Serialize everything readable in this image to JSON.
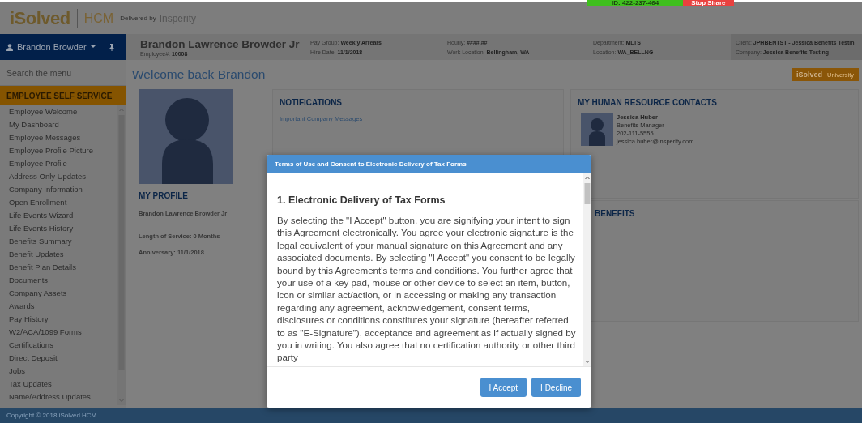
{
  "screen_share": {
    "id": "ID: 422-237-464",
    "stop": "Stop Share"
  },
  "header": {
    "logo": "iSolved",
    "product": "HCM",
    "delivered_by": "Delivered by",
    "partner": "Insperity"
  },
  "user_menu": {
    "name": "Brandon Browder"
  },
  "employee": {
    "name": "Brandon Lawrence Browder Jr",
    "number_label": "Employee#:",
    "number": "10008",
    "columns": [
      [
        {
          "label": "Pay Group:",
          "value": "Weekly Arrears"
        },
        {
          "label": "Hire Date:",
          "value": "11/1/2018"
        }
      ],
      [
        {
          "label": "Hourly:",
          "value": "####.##"
        },
        {
          "label": "Work Location:",
          "value": "Bellingham, WA"
        }
      ],
      [
        {
          "label": "Department:",
          "value": "MLTS"
        },
        {
          "label": "Location:",
          "value": "WA_BELLNG"
        }
      ],
      [
        {
          "label": "Client:",
          "value": "JPHBENTST - Jessica Benefits Testin"
        },
        {
          "label": "Company:",
          "value": "Jessica Benefits Testing"
        }
      ]
    ]
  },
  "search": {
    "placeholder": "Search the menu"
  },
  "menu": {
    "title": "EMPLOYEE SELF SERVICE",
    "items": [
      "Employee Welcome",
      "My Dashboard",
      "Employee Messages",
      "Employee Profile Picture",
      "Employee Profile",
      "Address Only Updates",
      "Company Information",
      "Open Enrollment",
      "Life Events Wizard",
      "Life Events History",
      "Benefits Summary",
      "Benefit Updates",
      "Benefit Plan Details",
      "Documents",
      "Company Assets",
      "Awards",
      "Pay History",
      "W2/ACA/1099 Forms",
      "Certifications",
      "Direct Deposit",
      "Jobs",
      "Tax Updates",
      "Name/Address Updates"
    ]
  },
  "welcome": "Welcome back Brandon",
  "university_badge": {
    "brand": "iSolved",
    "label": "University"
  },
  "profile": {
    "title": "MY PROFILE",
    "name": "Brandon Lawrence Browder Jr",
    "service": "Length of Service: 0 Months",
    "anniversary": "Anniversary: 11/1/2018"
  },
  "notifications": {
    "title": "NOTIFICATIONS",
    "link": "Important Company Messages"
  },
  "contacts": {
    "title": "MY HUMAN RESOURCE CONTACTS",
    "people": [
      {
        "name": "Jessica Huber",
        "role": "Benefits Manager",
        "phone": "202-111-5555",
        "email": "jessica.huber@insperity.com"
      }
    ]
  },
  "benefits": {
    "title": "BENEFITS"
  },
  "dialog": {
    "title": "Terms of Use and Consent to Electronic Delivery of Tax Forms",
    "heading": "1. Electronic Delivery of Tax Forms",
    "body": "By selecting the \"I Accept\" button, you are signifying your intent to sign this Agreement electronically. You agree your electronic signature is the legal equivalent of your manual signature on this Agreement and any associated documents. By selecting \"I Accept\" you consent to be legally bound by this Agreement's terms and conditions. You further agree that your use of a key pad, mouse or other device to select an item, button, icon or similar act/action, or in accessing or making any transaction regarding any agreement, acknowledgement, consent terms, disclosures or conditions constitutes your signature (hereafter referred to as \"E-Signature\"), acceptance and agreement as if actually signed by you in writing. You also agree that no certification authority or other third party",
    "buttons": [
      "I Accept",
      "I Decline"
    ]
  },
  "footer": "Copyright © 2018 iSolved HCM"
}
